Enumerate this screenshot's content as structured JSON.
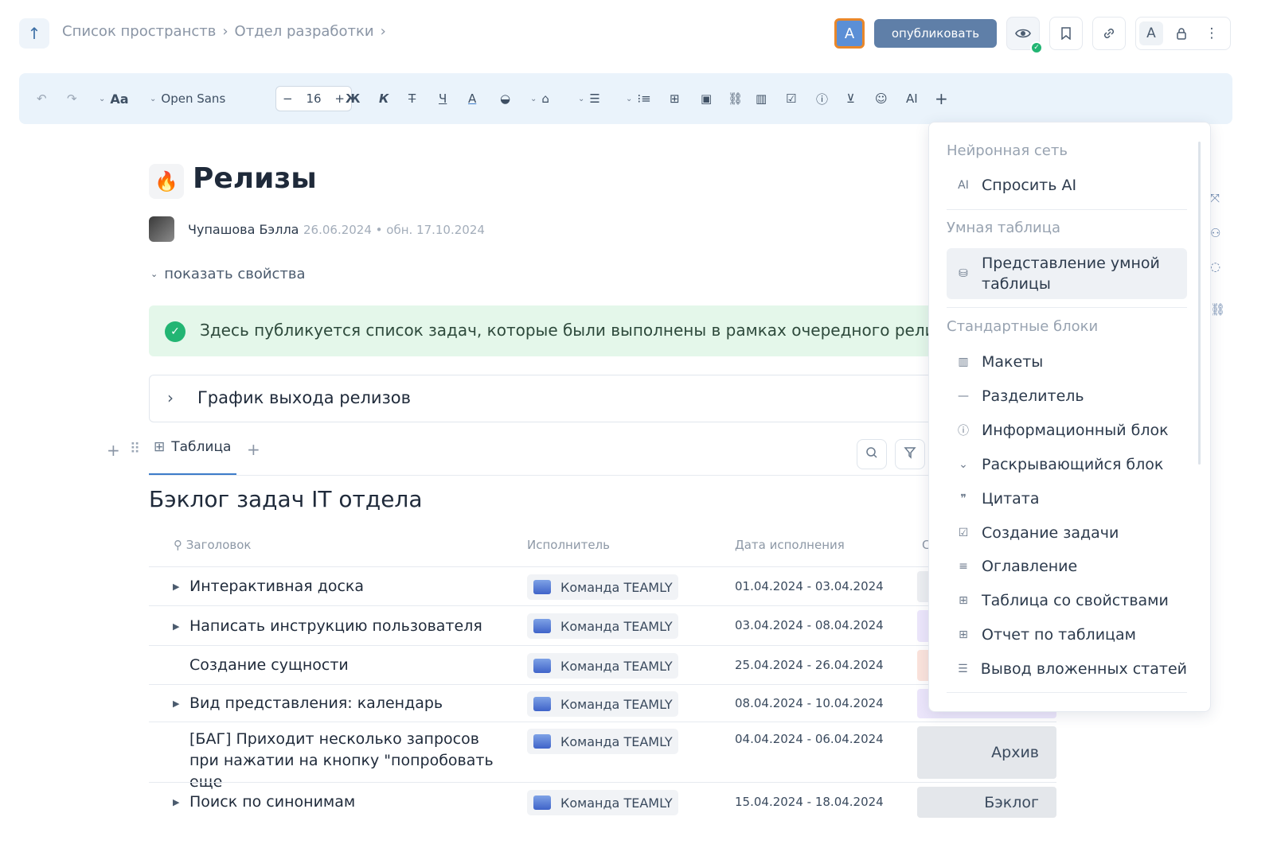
{
  "breadcrumb": {
    "items": [
      "Список пространств",
      "Отдел разработки"
    ],
    "separator": "›"
  },
  "header": {
    "user_initial": "A",
    "publish_label": "опубликовать",
    "misc_letter": "A"
  },
  "toolbar": {
    "font_name": "Open Sans",
    "font_size": "16",
    "text_style": "Aa",
    "bold": "Ж",
    "italic": "К",
    "strike": "Т",
    "underline": "Ч",
    "text_color": "A",
    "ai": "AI",
    "minus": "−",
    "plus": "+"
  },
  "page": {
    "emoji": "🔥",
    "title": "Релизы",
    "author": "Чупашова Бэлла",
    "dates": "26.06.2024 • обн. 17.10.2024",
    "show_properties": "показать свойства",
    "info_text": "Здесь публикуется список задач, которые были выполнены в рамках очередного релиза",
    "expand_title": "График выхода релизов"
  },
  "table_view": {
    "tab_label": "Таблица",
    "title": "Бэклог задач IT отдела",
    "columns": [
      "Заголовок",
      "Исполнитель",
      "Дата исполнения",
      "С"
    ],
    "rows": [
      {
        "title": "Интерактивная доска",
        "executor": "Команда TEAMLY",
        "date": "01.04.2024 - 03.04.2024",
        "status": "",
        "status_color": "#eceef1",
        "expandable": true
      },
      {
        "title": "Написать инструкцию пользователя",
        "executor": "Команда TEAMLY",
        "date": "03.04.2024 - 08.04.2024",
        "status": "",
        "status_color": "#ece6fb",
        "expandable": true
      },
      {
        "title": "Создание сущности",
        "executor": "Команда TEAMLY",
        "date": "25.04.2024 - 26.04.2024",
        "status": "",
        "status_color": "#fbe3dc",
        "expandable": false
      },
      {
        "title": "Вид представления: календарь",
        "executor": "Команда TEAMLY",
        "date": "08.04.2024 - 10.04.2024",
        "status": "",
        "status_color": "#ece6fb",
        "expandable": true
      },
      {
        "title": "[БАГ] Приходит несколько запросов при нажатии на кнопку \"попробовать еще",
        "executor": "Команда TEAMLY",
        "date": "04.04.2024 - 06.04.2024",
        "status": "Архив",
        "status_color": "#e4e7eb",
        "expandable": false
      },
      {
        "title": "Поиск по синонимам",
        "executor": "Команда TEAMLY",
        "date": "15.04.2024 - 18.04.2024",
        "status": "Бэклог",
        "status_color": "#e4e7eb",
        "expandable": true
      }
    ]
  },
  "menu": {
    "sections": [
      {
        "title": "Нейронная сеть",
        "items": [
          {
            "icon": "AI",
            "label": "Спросить AI"
          }
        ]
      },
      {
        "title": "Умная таблица",
        "items": [
          {
            "icon": "⛁",
            "label": "Представление умной таблицы"
          }
        ]
      },
      {
        "title": "Стандартные блоки",
        "items": [
          {
            "icon": "▥",
            "label": "Макеты"
          },
          {
            "icon": "—",
            "label": "Разделитель"
          },
          {
            "icon": "ⓘ",
            "label": "Информационный блок"
          },
          {
            "icon": "⌄",
            "label": "Раскрывающийся блок"
          },
          {
            "icon": "❞",
            "label": "Цитата"
          },
          {
            "icon": "☑",
            "label": "Создание задачи"
          },
          {
            "icon": "≡",
            "label": "Оглавление"
          },
          {
            "icon": "⊞",
            "label": "Таблица со свойствами"
          },
          {
            "icon": "⊞",
            "label": "Отчет по таблицам"
          },
          {
            "icon": "☰",
            "label": "Вывод вложенных статей"
          }
        ]
      }
    ]
  },
  "colors": {
    "accent": "#3d7cc9",
    "publish_button": "#5f7fa8",
    "toolbar_bg": "#eaf3fb",
    "info_bg": "#e4f7ea",
    "success": "#22b573"
  }
}
